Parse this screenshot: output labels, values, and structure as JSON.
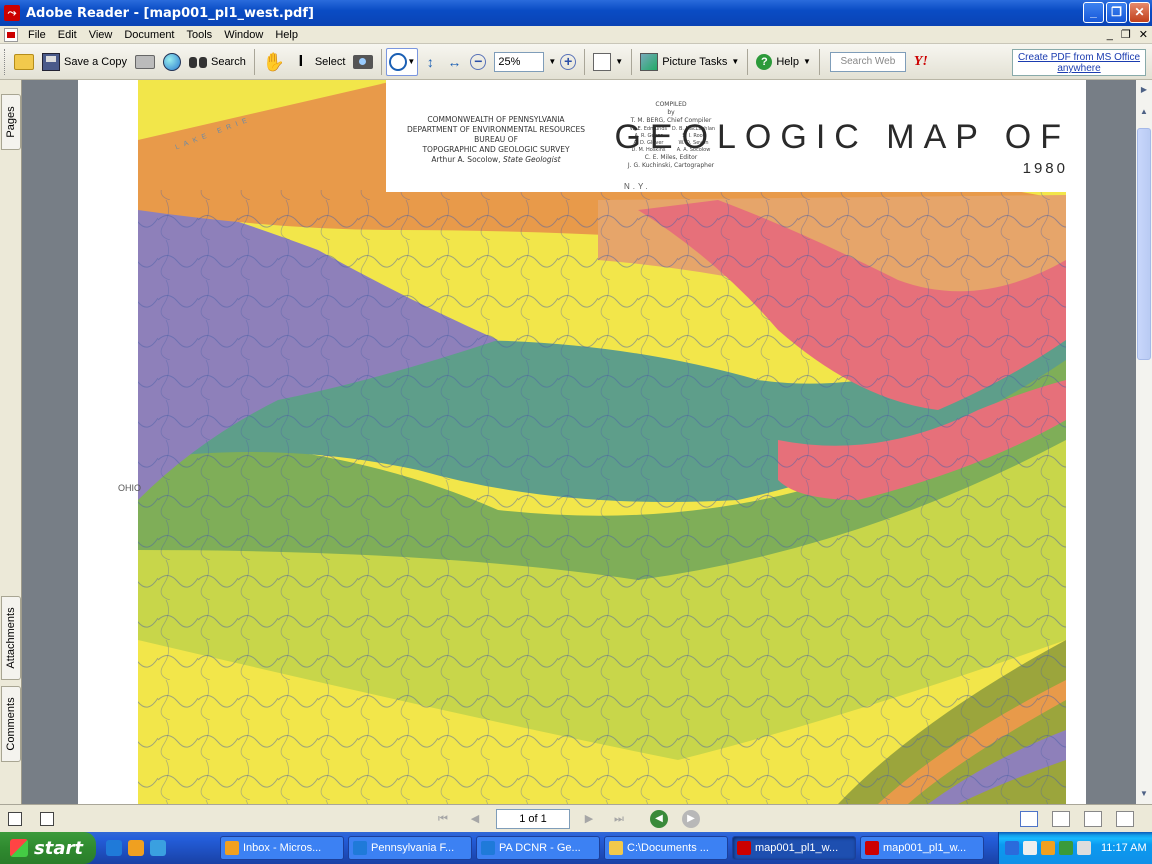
{
  "window": {
    "title": "Adobe Reader - [map001_pl1_west.pdf]",
    "controls": {
      "minimize": "_",
      "maximize": "❐",
      "close": "✕"
    }
  },
  "menubar": {
    "items": [
      "File",
      "Edit",
      "View",
      "Document",
      "Tools",
      "Window",
      "Help"
    ],
    "mdi": [
      "_",
      "❐",
      "✕"
    ]
  },
  "toolbar": {
    "save_copy_label": "Save a Copy",
    "search_label": "Search",
    "select_label": "Select",
    "zoom_value": "25%",
    "picture_tasks_label": "Picture Tasks",
    "help_label": "Help",
    "search_web_placeholder": "Search Web",
    "yahoo_label": "Y!",
    "create_pdf_line1": "Create PDF from MS Office",
    "create_pdf_line2": "anywhere"
  },
  "navpanel": {
    "tabs": [
      "Pages",
      "Attachments",
      "Comments"
    ]
  },
  "map": {
    "agency": [
      "COMMONWEALTH OF PENNSYLVANIA",
      "DEPARTMENT OF ENVIRONMENTAL RESOURCES",
      "BUREAU OF",
      "TOPOGRAPHIC AND GEOLOGIC SURVEY"
    ],
    "geologist_name": "Arthur A. Socolow, ",
    "geologist_title": "State Geologist",
    "compiled_label": "COMPILED",
    "compiled_by": "by",
    "chief_compiler": "T. M. BERG, Chief Compiler",
    "compilers": [
      "W. E. Edmunds",
      "D. B. MacLachlan",
      "A. R. Geyer",
      "S. I. Root",
      "A. D. Glover",
      "W. D. Sevon",
      "D. M. Hoskins",
      "A. A. Socolow"
    ],
    "editor": "C. E. Miles, Editor",
    "cartographer": "J. G. Kuchinski, Cartographer",
    "title": "GEOLOGIC MAP OF",
    "year": "1980",
    "ny_label": "N.Y.",
    "ohio_label": "OHIO",
    "lake_label": "LAKE ERIE",
    "colors": {
      "water": "#c9dde8",
      "yellow": "#f2e64a",
      "yellow_green": "#c8d64a",
      "green": "#7fae58",
      "teal": "#5e9e8a",
      "purple": "#8e80ba",
      "orange": "#e89a4a",
      "pink": "#e6707a",
      "tan": "#e6a56a",
      "olive": "#9ba53c"
    }
  },
  "statusbar": {
    "page_indicator": "1 of 1"
  },
  "taskbar": {
    "start_label": "start",
    "tasks": [
      "Inbox - Micros...",
      "Pennsylvania F...",
      "PA DCNR - Ge...",
      "C:\\Documents ...",
      "map001_pl1_w...",
      "map001_pl1_w..."
    ],
    "clock": "11:17 AM"
  }
}
